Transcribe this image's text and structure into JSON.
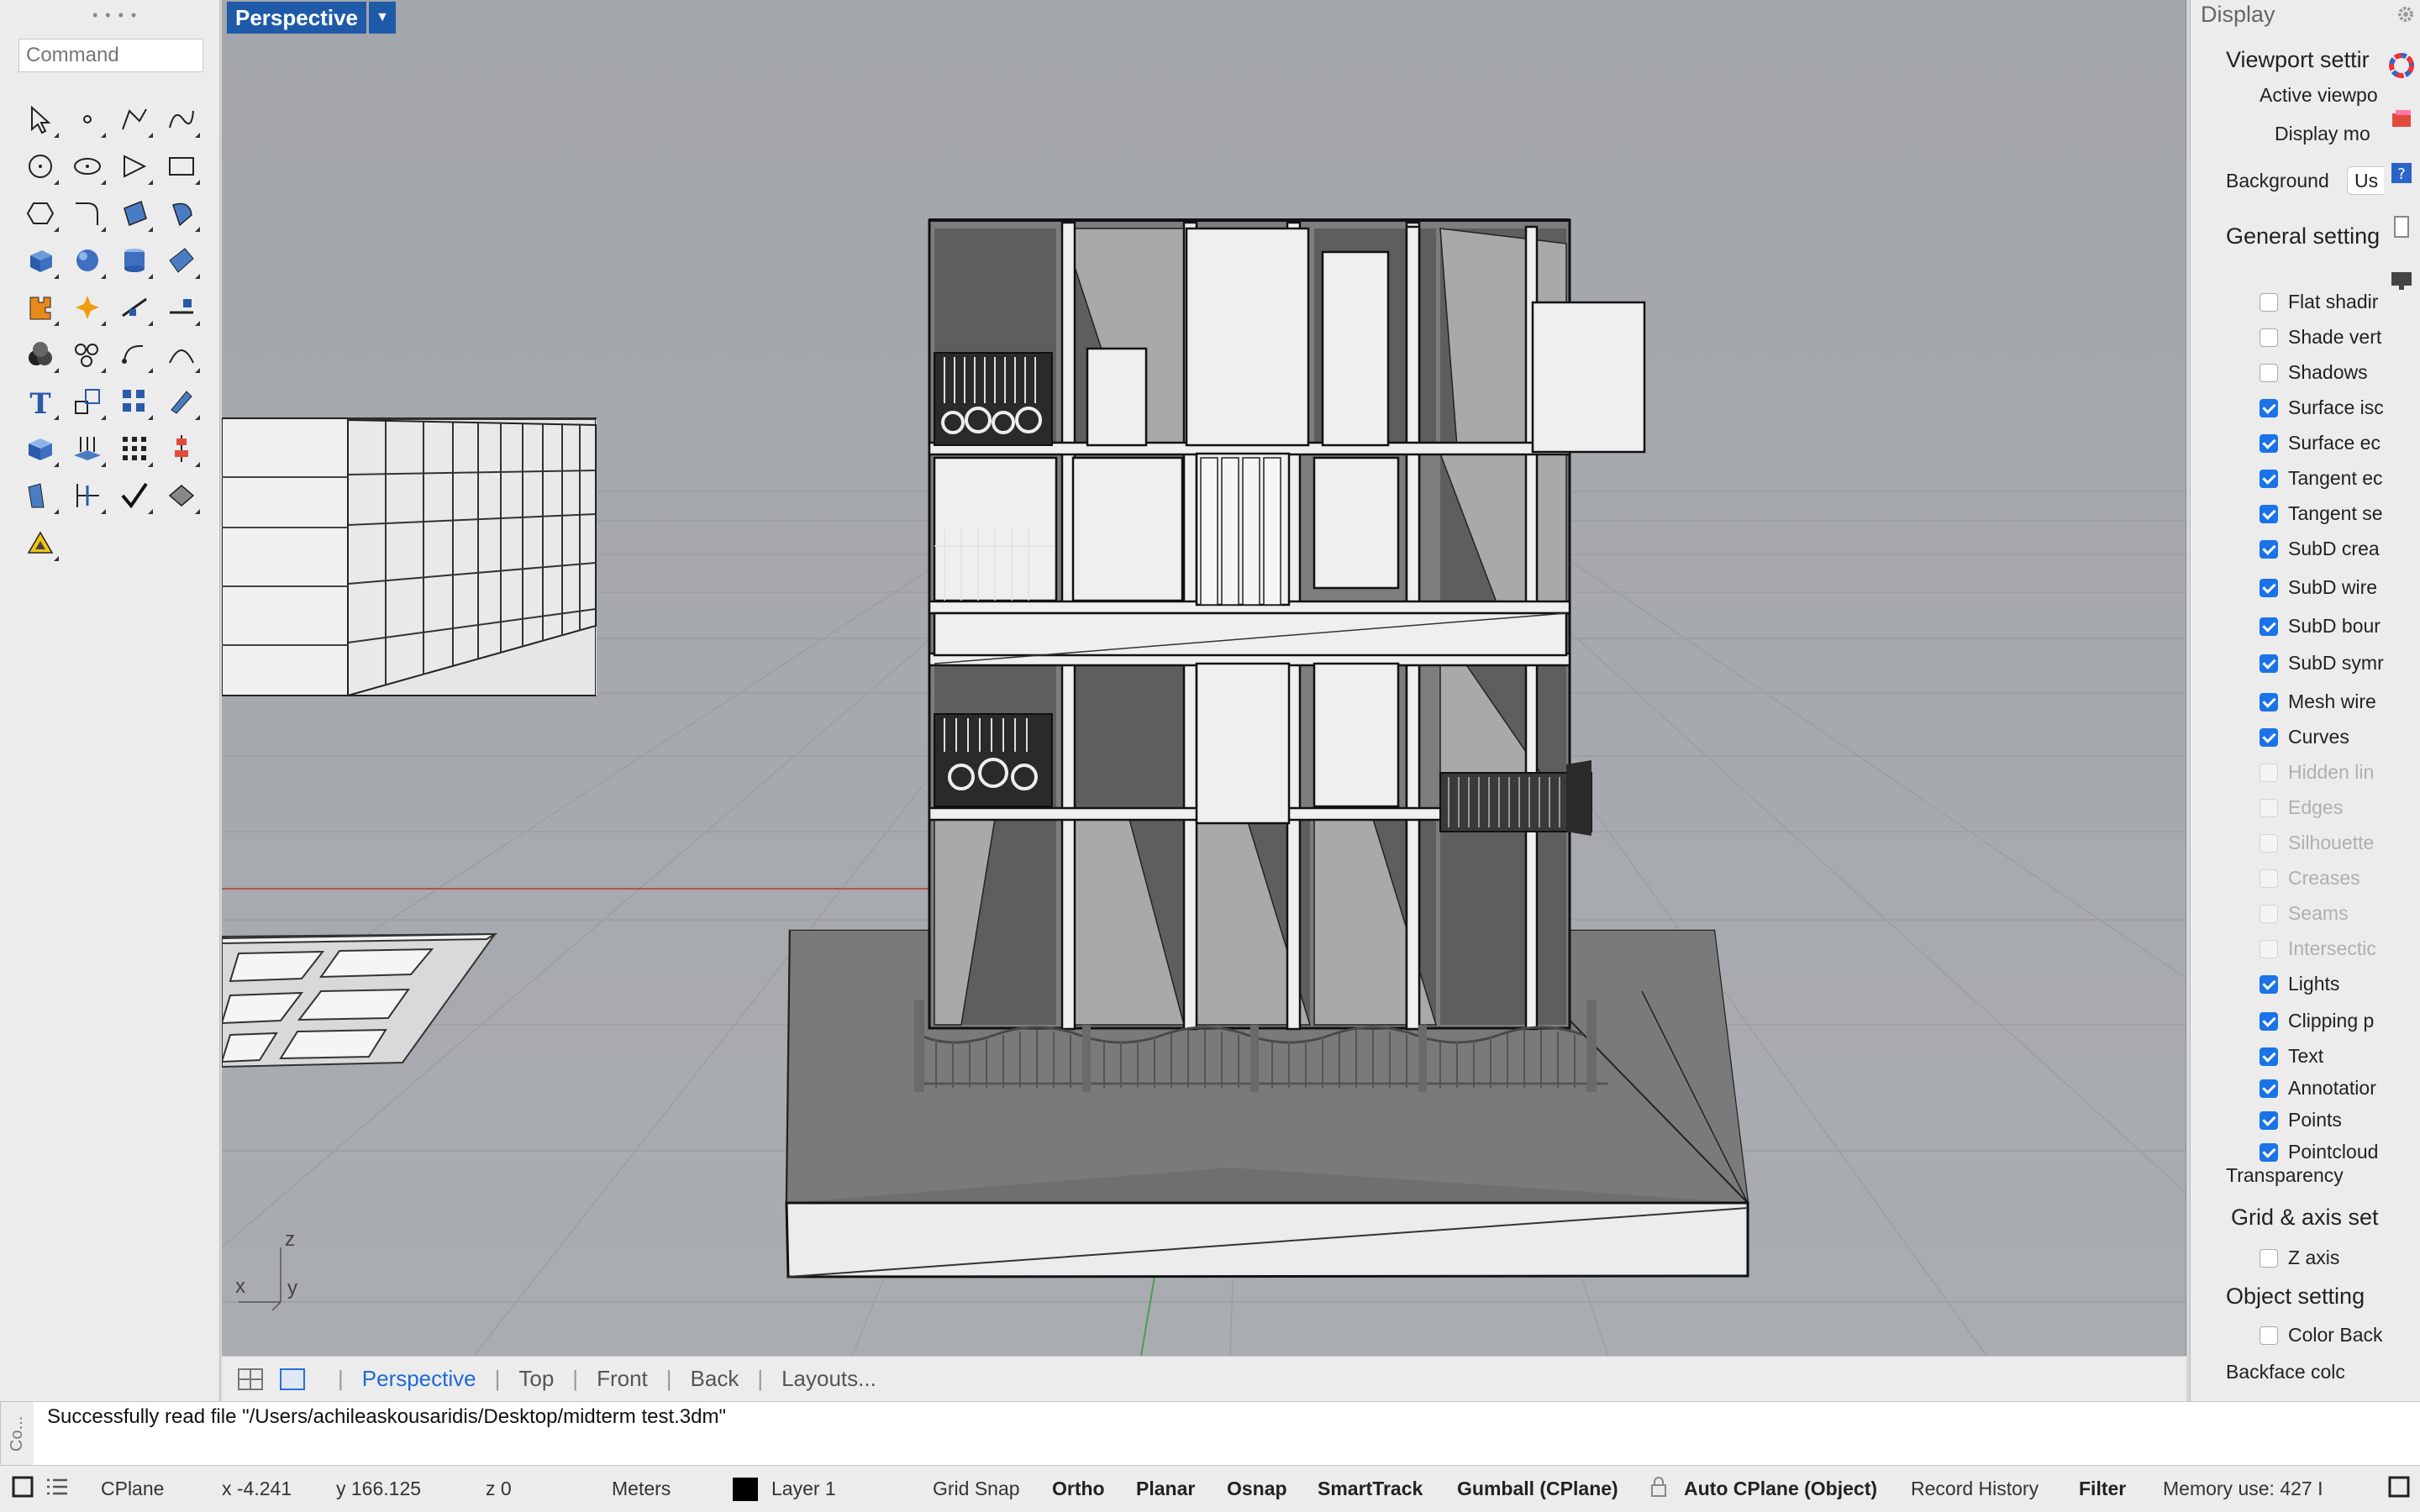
{
  "command": {
    "placeholder": "Command"
  },
  "tool_icons": [
    "select-arrow-icon",
    "point-icon",
    "polyline-icon",
    "curve-icon",
    "circle-icon",
    "ellipse-icon",
    "polygon-icon",
    "rectangle-icon",
    "hexagon-icon",
    "fillet-curve-icon",
    "surface-icon",
    "patch-icon",
    "box-icon",
    "sphere-icon",
    "cylinder-icon",
    "plane-surface-icon",
    "puzzle-icon",
    "explode-icon",
    "trim-icon",
    "split-icon",
    "boolean-icon",
    "group-icon",
    "rotate-icon",
    "arc-icon",
    "text-icon",
    "scale-icon",
    "array-icon",
    "edit-icon",
    "solid-icon",
    "extrude-icon",
    "grid-array-icon",
    "align-icon",
    "layout-icon",
    "analyze-icon",
    "check-icon",
    "render-icon",
    "light-icon"
  ],
  "viewport": {
    "title": "Perspective",
    "axis_labels": {
      "z": "z",
      "x": "x",
      "y": "y"
    }
  },
  "viewport_tabs": [
    "Perspective",
    "Top",
    "Front",
    "Back",
    "Layouts..."
  ],
  "display_panel": {
    "title": "Display",
    "viewport_settings": "Viewport settir",
    "active_viewport": "Active viewpo",
    "display_mode": "Display mo",
    "background_label": "Background",
    "background_value": "Us",
    "general_settings": "General setting",
    "checks": [
      {
        "label": "Flat shadir",
        "state": "off"
      },
      {
        "label": "Shade vert",
        "state": "off"
      },
      {
        "label": "Shadows",
        "state": "off"
      },
      {
        "label": "Surface isc",
        "state": "on"
      },
      {
        "label": "Surface ec",
        "state": "on"
      },
      {
        "label": "Tangent ec",
        "state": "on"
      },
      {
        "label": "Tangent se",
        "state": "on"
      },
      {
        "label": "SubD crea",
        "state": "on"
      },
      {
        "label": "SubD wire",
        "state": "on"
      },
      {
        "label": "SubD bour",
        "state": "on"
      },
      {
        "label": "SubD symr",
        "state": "on"
      },
      {
        "label": "Mesh wire",
        "state": "on"
      },
      {
        "label": "Curves",
        "state": "on"
      },
      {
        "label": "Hidden lin",
        "state": "disabled"
      },
      {
        "label": "Edges",
        "state": "disabled"
      },
      {
        "label": "Silhouette",
        "state": "disabled"
      },
      {
        "label": "Creases",
        "state": "disabled"
      },
      {
        "label": "Seams",
        "state": "disabled"
      },
      {
        "label": "Intersectic",
        "state": "disabled"
      },
      {
        "label": "Lights",
        "state": "on"
      },
      {
        "label": "Clipping p",
        "state": "on"
      },
      {
        "label": "Text",
        "state": "on"
      },
      {
        "label": "Annotatior",
        "state": "on"
      },
      {
        "label": "Points",
        "state": "on"
      },
      {
        "label": "Pointcloud",
        "state": "on"
      }
    ],
    "transparency": "Transparency",
    "grid_axis": "Grid & axis set",
    "z_axis": "Z axis",
    "object_settings": "Object setting",
    "color_back": "Color Back",
    "backface_color": "Backface colc"
  },
  "command_history": {
    "side_label": "Co...",
    "message": "Successfully read file \"/Users/achileaskousaridis/Desktop/midterm test.3dm\""
  },
  "status": {
    "cplane": "CPlane",
    "x": "x -4.241",
    "y": "y 166.125",
    "z": "z 0",
    "units": "Meters",
    "layer": "Layer 1",
    "grid_snap": "Grid Snap",
    "ortho": "Ortho",
    "planar": "Planar",
    "osnap": "Osnap",
    "smarttrack": "SmartTrack",
    "gumball": "Gumball (CPlane)",
    "auto_cplane": "Auto CPlane (Object)",
    "record_history": "Record History",
    "filter": "Filter",
    "memory": "Memory use: 427 I"
  }
}
